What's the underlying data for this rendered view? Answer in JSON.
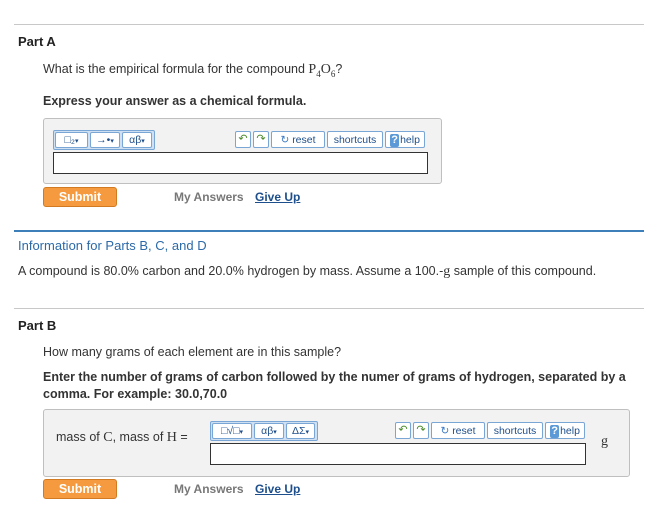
{
  "partA": {
    "title": "Part A",
    "question_prefix": "What is the empirical formula for the compound ",
    "formula": {
      "e1": "P",
      "n1": "4",
      "e2": "O",
      "n2": "6"
    },
    "question_suffix": "?",
    "instruction": "Express your answer as a chemical formula.",
    "toolbar": {
      "template_glyph": "□₂",
      "arrow_glyph": "→•",
      "greek_glyph": "αβ",
      "reset": "reset",
      "shortcuts": "shortcuts",
      "help": "help",
      "help_mark": "?"
    },
    "answer_value": "",
    "submit": "Submit",
    "my_answers": "My Answers",
    "give_up": "Give Up"
  },
  "info": {
    "title": "Information for Parts B, C, and D",
    "text_before": "A compound is 80.0% carbon and 20.0% hydrogen by mass. Assume a 100.-",
    "unit": "g",
    "text_after": " sample of this compound."
  },
  "partB": {
    "title": "Part B",
    "question": "How many grams of each element are in this sample?",
    "instruction": "Enter the number of grams of carbon followed by the numer of grams of hydrogen, separated by a comma. For example: 30.0,70.0",
    "label_prefix": "mass of ",
    "label_c": "C",
    "label_mid": ", mass of ",
    "label_h": "H",
    "label_eq": " =",
    "toolbar": {
      "template_glyph": "□√□",
      "greek_glyph": "αβ",
      "delta_glyph": "ΔΣ",
      "reset": "reset",
      "shortcuts": "shortcuts",
      "help": "help",
      "help_mark": "?"
    },
    "answer_value": "",
    "unit": "g",
    "submit": "Submit",
    "my_answers": "My Answers",
    "give_up": "Give Up"
  }
}
